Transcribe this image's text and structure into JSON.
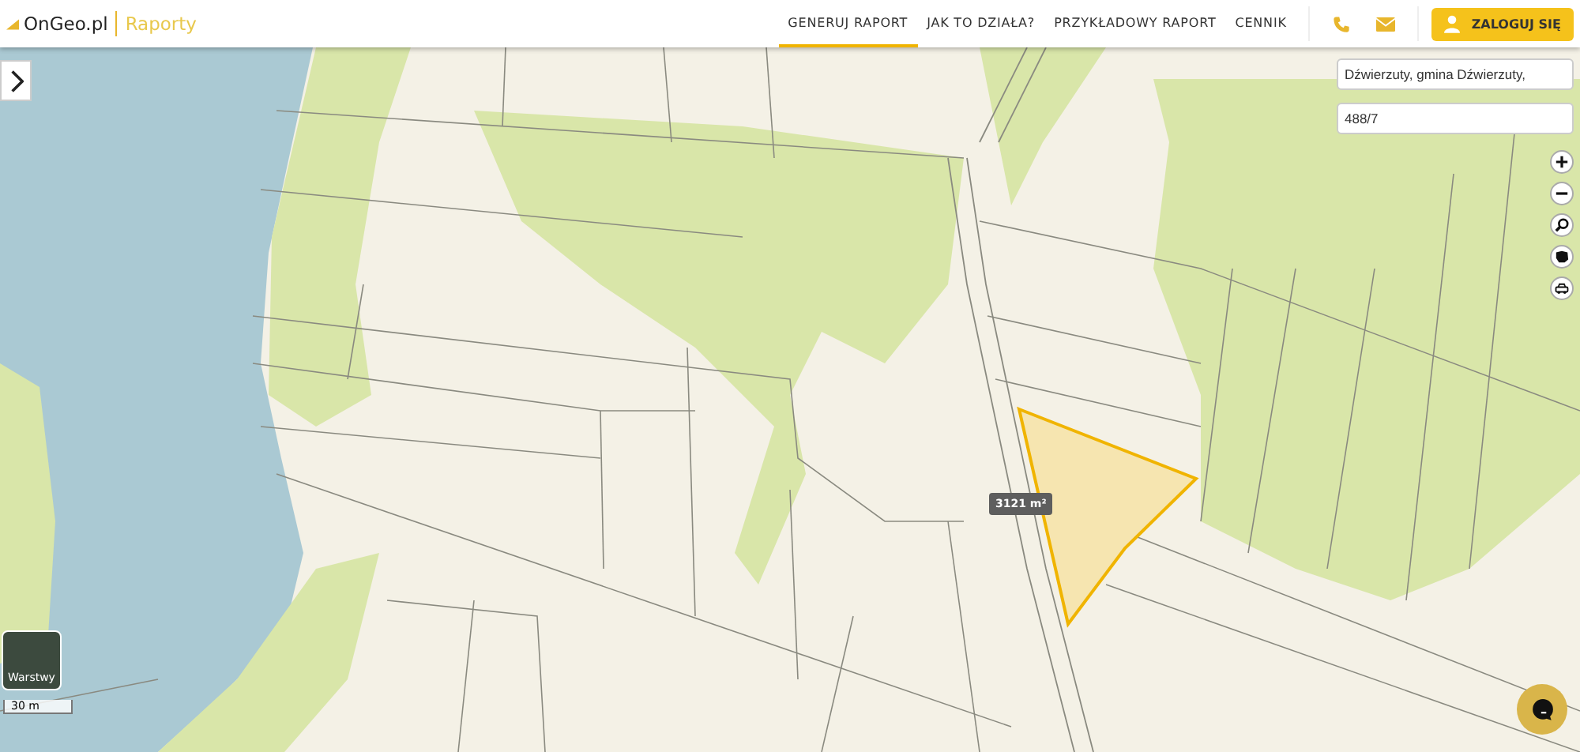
{
  "logo": {
    "brand": "OnGeo.pl",
    "product": "Raporty"
  },
  "nav": [
    {
      "label": "GENERUJ RAPORT",
      "selected": true
    },
    {
      "label": "JAK TO DZIAŁA?",
      "selected": false
    },
    {
      "label": "PRZYKŁADOWY RAPORT",
      "selected": false
    },
    {
      "label": "CENNIK",
      "selected": false
    }
  ],
  "login_button": {
    "label": "ZALOGUJ SIĘ"
  },
  "map": {
    "search_fields": [
      {
        "value": "Dźwierzuty, gmina Dźwierzuty,"
      },
      {
        "value": "488/7"
      }
    ],
    "area_label": "3121 m²",
    "layers_button": {
      "label": "Warstwy"
    },
    "scale": "30 m"
  }
}
